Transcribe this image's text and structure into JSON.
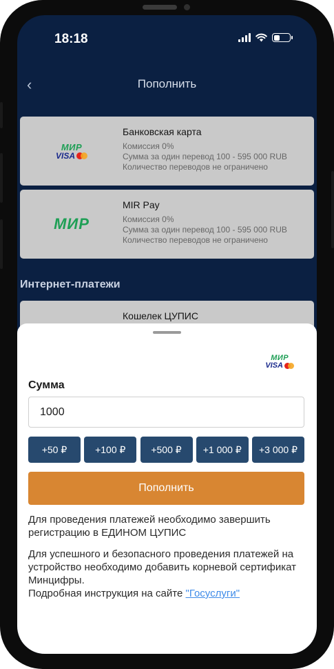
{
  "status_bar": {
    "time": "18:18"
  },
  "header": {
    "back_glyph": "‹",
    "title": "Пополнить"
  },
  "methods": [
    {
      "logo": "mir-visa-mastercard-logo",
      "name": "Банковская карта",
      "lines": [
        "Комиссия 0%",
        "Сумма за один перевод 100 - 595 000 RUB",
        "Количество переводов не ограничено"
      ]
    },
    {
      "logo": "mir-logo",
      "name": "MIR Pay",
      "lines": [
        "Комиссия 0%",
        "Сумма за один перевод 100 - 595 000 RUB",
        "Количество переводов не ограничено"
      ]
    }
  ],
  "logos": {
    "mir": "МИР",
    "visa": "VISA"
  },
  "internet_section": {
    "title": "Интернет-платежи",
    "wallet_name": "Кошелек ЦУПИС"
  },
  "sheet": {
    "amount_label": "Сумма",
    "amount_value": "1000",
    "quick_amounts": [
      "+50 ₽",
      "+100 ₽",
      "+500 ₽",
      "+1 000 ₽",
      "+3 000 ₽"
    ],
    "submit_label": "Пополнить",
    "note1": "Для проведения платежей необходимо завершить регистрацию в ЕДИНОМ ЦУПИС",
    "note2": "Для успешного и безопасного проведения платежей на устройство необходимо добавить корневой сертификат Минцифры.",
    "note3_prefix": "Подробная инструкция на сайте ",
    "note3_link": "\"Госуслуги\""
  },
  "colors": {
    "background_dark": "#0b2042",
    "card_gray": "#c9c9c9",
    "quick_button": "#27496e",
    "submit_button": "#d88632",
    "mir_green": "#1e9f55",
    "visa_blue": "#1a2a8c",
    "link": "#3d8ae8"
  }
}
